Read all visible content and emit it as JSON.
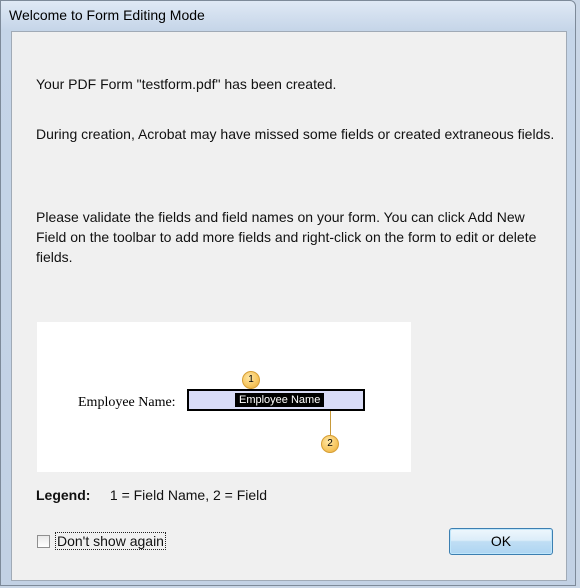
{
  "window": {
    "title": "Welcome to Form Editing Mode"
  },
  "messages": {
    "created": "Your PDF Form \"testform.pdf\" has been created.",
    "missed": "During creation, Acrobat may have missed some fields or created extraneous fields.",
    "validate": "Please validate the fields and field names on your form. You can click Add New Field on the toolbar to add more fields and right-click on the form to edit or delete fields."
  },
  "diagram": {
    "label": "Employee Name:",
    "field_name": "Employee Name",
    "callout_1": "1",
    "callout_2": "2"
  },
  "legend": {
    "title": "Legend:",
    "text": "1 = Field Name, 2 = Field"
  },
  "footer": {
    "checkbox_label": "Don't show again",
    "checkbox_checked": false,
    "ok_label": "OK"
  },
  "colors": {
    "field_fill": "#d9dcf7",
    "callout_fill": "#f7c65e",
    "ok_button_border": "#3c7fb1"
  }
}
